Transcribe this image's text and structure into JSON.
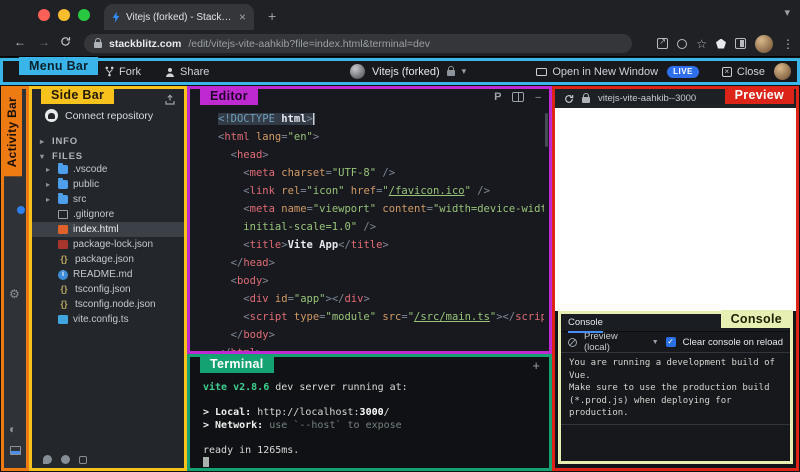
{
  "browser": {
    "tab_title": "Vitejs (forked) - StackBlitz",
    "url_host": "stackblitz.com",
    "url_path": "/edit/vitejs-vite-aahkib?file=index.html&terminal=dev"
  },
  "annotations": {
    "menu_bar": "Menu Bar",
    "activity_bar": "Activity Bar",
    "side_bar": "Side Bar",
    "editor": "Editor",
    "terminal": "Terminal",
    "preview": "Preview",
    "console": "Console",
    "colors": {
      "menu_bar": "#3ab5ea",
      "activity_bar": "#ee7a12",
      "side_bar": "#f8c21c",
      "editor": "#bf2ad0",
      "terminal": "#15a273",
      "preview": "#dd2418",
      "console": "#e7f0b2"
    }
  },
  "icons": {
    "back": "←",
    "forward": "→",
    "star": "☆",
    "kebab": "⋮",
    "plus": "+",
    "close_x": "×",
    "chevron_down": "▾",
    "chevron_right": "▸",
    "dropdown": "▼",
    "gear": "⚙",
    "theme": "◐",
    "check": "✓",
    "dash": "‒"
  },
  "menubar": {
    "fork": "Fork",
    "share": "Share",
    "project": "Vitejs (forked)",
    "open_new_window": "Open in New Window",
    "live": "LIVE",
    "close": "Close"
  },
  "sidebar": {
    "connect": "Connect repository",
    "info": "INFO",
    "files_header": "FILES",
    "tree": [
      {
        "name": ".vscode",
        "type": "folder"
      },
      {
        "name": "public",
        "type": "folder"
      },
      {
        "name": "src",
        "type": "folder"
      },
      {
        "name": ".gitignore",
        "type": "file",
        "icon": "doc"
      },
      {
        "name": "index.html",
        "type": "file",
        "icon": "html",
        "selected": true
      },
      {
        "name": "package-lock.json",
        "type": "file",
        "icon": "lockjson"
      },
      {
        "name": "package.json",
        "type": "file",
        "icon": "braces"
      },
      {
        "name": "README.md",
        "type": "file",
        "icon": "info"
      },
      {
        "name": "tsconfig.json",
        "type": "file",
        "icon": "braces"
      },
      {
        "name": "tsconfig.node.json",
        "type": "file",
        "icon": "braces"
      },
      {
        "name": "vite.config.ts",
        "type": "file",
        "icon": "ts"
      }
    ]
  },
  "editor": {
    "prettier_label": "P",
    "code": [
      {
        "ind": 0,
        "sel": true,
        "t": [
          [
            "dt",
            "<!DOCTYPE "
          ],
          [
            "tb",
            "html"
          ],
          [
            "pn",
            ">"
          ]
        ]
      },
      {
        "ind": 0,
        "t": [
          [
            "pn",
            "<"
          ],
          [
            "tg",
            "html"
          ],
          [
            "at",
            " lang"
          ],
          [
            "pn",
            "="
          ],
          [
            "st",
            "\"en\""
          ],
          [
            "pn",
            ">"
          ]
        ]
      },
      {
        "ind": 2,
        "t": [
          [
            "pn",
            "<"
          ],
          [
            "tg",
            "head"
          ],
          [
            "pn",
            ">"
          ]
        ]
      },
      {
        "ind": 4,
        "t": [
          [
            "pn",
            "<"
          ],
          [
            "tg",
            "meta"
          ],
          [
            "at",
            " charset"
          ],
          [
            "pn",
            "="
          ],
          [
            "st",
            "\"UTF-8\""
          ],
          [
            "pn",
            " />"
          ]
        ]
      },
      {
        "ind": 4,
        "t": [
          [
            "pn",
            "<"
          ],
          [
            "tg",
            "link"
          ],
          [
            "at",
            " rel"
          ],
          [
            "pn",
            "="
          ],
          [
            "st",
            "\"icon\""
          ],
          [
            "at",
            " href"
          ],
          [
            "pn",
            "="
          ],
          [
            "st",
            "\""
          ],
          [
            "lk",
            "/favicon.ico"
          ],
          [
            "st",
            "\""
          ],
          [
            "pn",
            " />"
          ]
        ]
      },
      {
        "ind": 4,
        "t": [
          [
            "pn",
            "<"
          ],
          [
            "tg",
            "meta"
          ],
          [
            "at",
            " name"
          ],
          [
            "pn",
            "="
          ],
          [
            "st",
            "\"viewport\""
          ],
          [
            "at",
            " content"
          ],
          [
            "pn",
            "="
          ],
          [
            "st",
            "\"width=device-width,"
          ]
        ]
      },
      {
        "ind": 4,
        "t": [
          [
            "st",
            "initial-scale=1.0\""
          ],
          [
            "pn",
            " />"
          ]
        ]
      },
      {
        "ind": 4,
        "t": [
          [
            "pn",
            "<"
          ],
          [
            "tg",
            "title"
          ],
          [
            "pn",
            ">"
          ],
          [
            "tb",
            "Vite App"
          ],
          [
            "pn",
            "</"
          ],
          [
            "tg",
            "title"
          ],
          [
            "pn",
            ">"
          ]
        ]
      },
      {
        "ind": 2,
        "t": [
          [
            "pn",
            "</"
          ],
          [
            "tg",
            "head"
          ],
          [
            "pn",
            ">"
          ]
        ]
      },
      {
        "ind": 2,
        "t": [
          [
            "pn",
            "<"
          ],
          [
            "tg",
            "body"
          ],
          [
            "pn",
            ">"
          ]
        ]
      },
      {
        "ind": 4,
        "t": [
          [
            "pn",
            "<"
          ],
          [
            "tg",
            "div"
          ],
          [
            "at",
            " id"
          ],
          [
            "pn",
            "="
          ],
          [
            "st",
            "\"app\""
          ],
          [
            "pn",
            "></"
          ],
          [
            "tg",
            "div"
          ],
          [
            "pn",
            ">"
          ]
        ]
      },
      {
        "ind": 4,
        "t": [
          [
            "pn",
            "<"
          ],
          [
            "tg",
            "script"
          ],
          [
            "at",
            " type"
          ],
          [
            "pn",
            "="
          ],
          [
            "st",
            "\"module\""
          ],
          [
            "at",
            " src"
          ],
          [
            "pn",
            "="
          ],
          [
            "st",
            "\""
          ],
          [
            "lk",
            "/src/main.ts"
          ],
          [
            "st",
            "\""
          ],
          [
            "pn",
            "></"
          ],
          [
            "tg",
            "script"
          ],
          [
            "pn",
            ">"
          ]
        ]
      },
      {
        "ind": 2,
        "t": [
          [
            "pn",
            "</"
          ],
          [
            "tg",
            "body"
          ],
          [
            "pn",
            ">"
          ]
        ]
      },
      {
        "ind": 0,
        "t": [
          [
            "pn",
            "</"
          ],
          [
            "tg",
            "html"
          ],
          [
            "pn",
            ">"
          ]
        ]
      }
    ]
  },
  "terminal": {
    "lines": [
      {
        "t": [
          [
            "g",
            "vite v2.8.6"
          ],
          [
            "w",
            " dev server running at:"
          ]
        ]
      },
      {
        "t": []
      },
      {
        "t": [
          [
            "b",
            "> Local: "
          ],
          [
            "w",
            "http://localhost:"
          ],
          [
            "bw",
            "3000"
          ],
          [
            "w",
            "/"
          ]
        ]
      },
      {
        "t": [
          [
            "b",
            "> Network: "
          ],
          [
            "d",
            "use `--host` to expose"
          ]
        ]
      },
      {
        "t": []
      },
      {
        "t": [
          [
            "w",
            "ready in 1265ms."
          ]
        ]
      }
    ]
  },
  "preview": {
    "url": "vitejs-vite-aahkib--3000"
  },
  "console": {
    "tab": "Console",
    "dropdown_value": "Preview (local)",
    "checkbox_label": "Clear console on reload",
    "message_lines": [
      "You are running a development build of Vue.",
      "Make sure to use the production build",
      "(*.prod.js) when deploying for production."
    ]
  }
}
